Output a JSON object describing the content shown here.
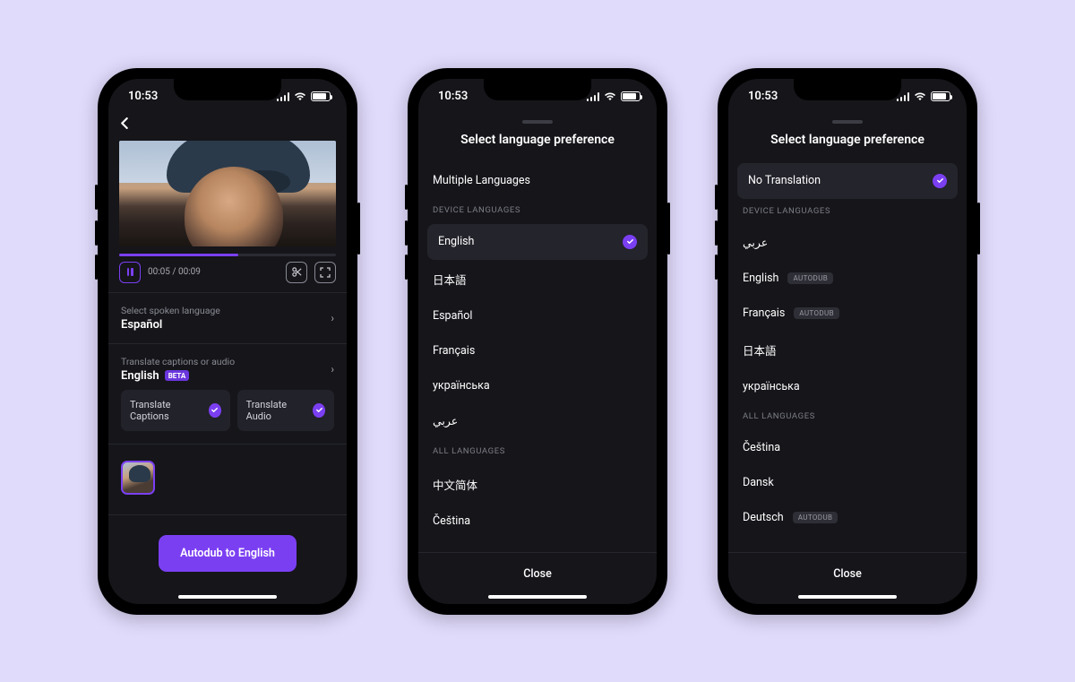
{
  "status": {
    "time": "10:53"
  },
  "phone1": {
    "progress_pct": 55,
    "time_text": "00:05 / 00:09",
    "spoken": {
      "label": "Select spoken language",
      "value": "Español"
    },
    "translate": {
      "label": "Translate captions or audio",
      "value": "English",
      "beta": "BETA"
    },
    "toggle_captions": "Translate Captions",
    "toggle_audio": "Translate Audio",
    "cta": "Autodub to English"
  },
  "sheet_title": "Select language preference",
  "headers": {
    "device": "DEVICE LANGUAGES",
    "all": "ALL LANGUAGES"
  },
  "close": "Close",
  "phone2": {
    "top_option": "Multiple Languages",
    "device": [
      "English",
      "日本語",
      "Español",
      "Français",
      "українська",
      "عربي"
    ],
    "selected_index": 0,
    "all": [
      "中文简体",
      "Čeština"
    ]
  },
  "phone3": {
    "top_option": "No Translation",
    "top_selected": true,
    "device": [
      {
        "label": "عربي",
        "autodub": false
      },
      {
        "label": "English",
        "autodub": true
      },
      {
        "label": "Français",
        "autodub": true
      },
      {
        "label": "日本語",
        "autodub": false
      },
      {
        "label": "українська",
        "autodub": false
      }
    ],
    "all": [
      {
        "label": "Čeština",
        "autodub": false
      },
      {
        "label": "Dansk",
        "autodub": false
      },
      {
        "label": "Deutsch",
        "autodub": true
      }
    ],
    "autodub_label": "AUTODUB"
  }
}
